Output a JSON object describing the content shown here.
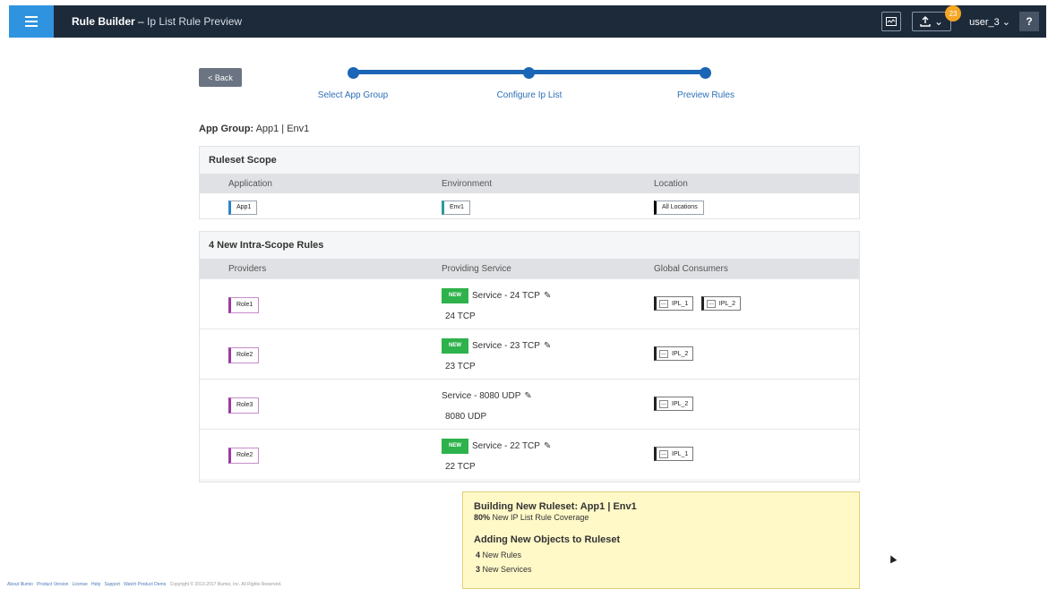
{
  "header": {
    "app_name": "Rule Builder",
    "separator": " – ",
    "page_name": "Ip List Rule Preview",
    "notification_count": "23",
    "user": "user_3",
    "help_label": "?"
  },
  "back_label": "< Back",
  "steps": [
    "Select App Group",
    "Configure Ip List",
    "Preview Rules"
  ],
  "app_group": {
    "label": "App Group:",
    "value": "App1 | Env1"
  },
  "scope": {
    "title": "Ruleset Scope",
    "headers": [
      "Application",
      "Environment",
      "Location"
    ],
    "values": [
      "App1",
      "Env1",
      "All Locations"
    ]
  },
  "rules": {
    "title": "4 New Intra-Scope Rules",
    "headers": [
      "Providers",
      "Providing Service",
      "Global Consumers"
    ],
    "new_label": "NEW",
    "rows": [
      {
        "provider": "Role1",
        "is_new": true,
        "service": "Service - 24 TCP",
        "port": "24 TCP",
        "consumers": [
          "IPL_1",
          "IPL_2"
        ]
      },
      {
        "provider": "Role2",
        "is_new": true,
        "service": "Service - 23 TCP",
        "port": "23 TCP",
        "consumers": [
          "IPL_2"
        ]
      },
      {
        "provider": "Role3",
        "is_new": false,
        "service": "Service - 8080 UDP",
        "port": "8080 UDP",
        "consumers": [
          "IPL_2"
        ]
      },
      {
        "provider": "Role2",
        "is_new": true,
        "service": "Service - 22 TCP",
        "port": "22 TCP",
        "consumers": [
          "IPL_1"
        ]
      }
    ]
  },
  "summary": {
    "title": "Building New Ruleset: App1 | Env1",
    "coverage_pct": "80%",
    "coverage_text": " New IP List Rule Coverage",
    "adding_title": "Adding New Objects to Ruleset",
    "items": [
      {
        "count": "4",
        "label": " New Rules"
      },
      {
        "count": "3",
        "label": " New Services"
      }
    ]
  },
  "footer": {
    "links": [
      "About Illumio",
      "Product Version",
      "License",
      "Help",
      "Support",
      "Watch Product Demo"
    ],
    "copyright": "Copyright © 2013-2017 Illumio, Inc. All Rights Reserved."
  }
}
